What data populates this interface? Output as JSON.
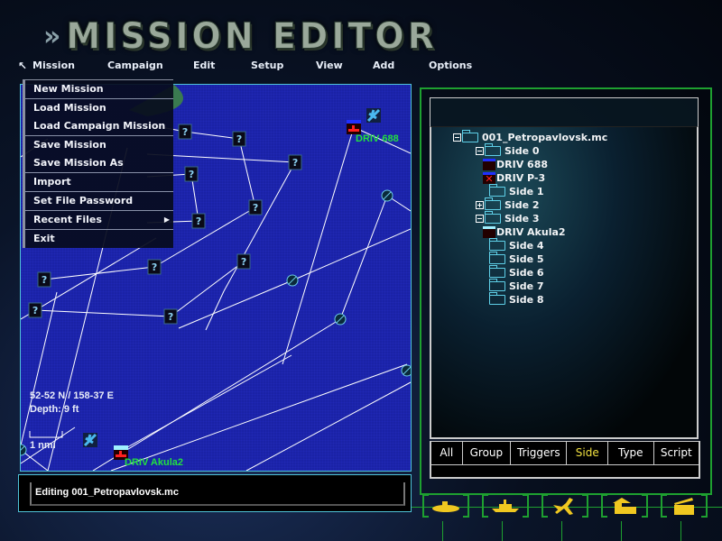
{
  "title": "MISSION EDITOR",
  "menubar": [
    "Mission",
    "Campaign",
    "Edit",
    "Setup",
    "View",
    "Add",
    "Options"
  ],
  "mission_menu": [
    "New Mission",
    "Load Mission",
    "Load Campaign Mission",
    "Save Mission",
    "Save Mission As",
    "Import",
    "Set File Password",
    "Recent Files",
    "Exit"
  ],
  "map": {
    "coordinates": "52-52 N / 158-37 E",
    "depth": "Depth: 9 ft",
    "scale": "1 nmi",
    "unit_labels": [
      "DRIV 688",
      "DRIV Akula2"
    ],
    "waypoint_glyph": "?"
  },
  "status": "Editing 001_Petropavlovsk.mc",
  "tree": {
    "root": "001_Petropavlovsk.mc",
    "nodes": [
      "Side 0",
      "DRIV 688",
      "DRIV P-3",
      "Side 1",
      "Side 2",
      "Side 3",
      "DRIV Akula2",
      "Side 4",
      "Side 5",
      "Side 6",
      "Side 7",
      "Side 8"
    ]
  },
  "tabs": [
    "All",
    "Group",
    "Triggers",
    "Side",
    "Type",
    "Script"
  ],
  "active_tab": "Side",
  "bottom_buttons": [
    "submarine-icon",
    "ship-icon",
    "aircraft-icon",
    "land-base-icon",
    "clapperboard-icon"
  ],
  "colors": {
    "map_sea": "#1a22a6",
    "unit_label": "#22e040",
    "accent_green": "#1ea030",
    "active_tab": "#f0e040",
    "button_icon": "#f0c820"
  }
}
